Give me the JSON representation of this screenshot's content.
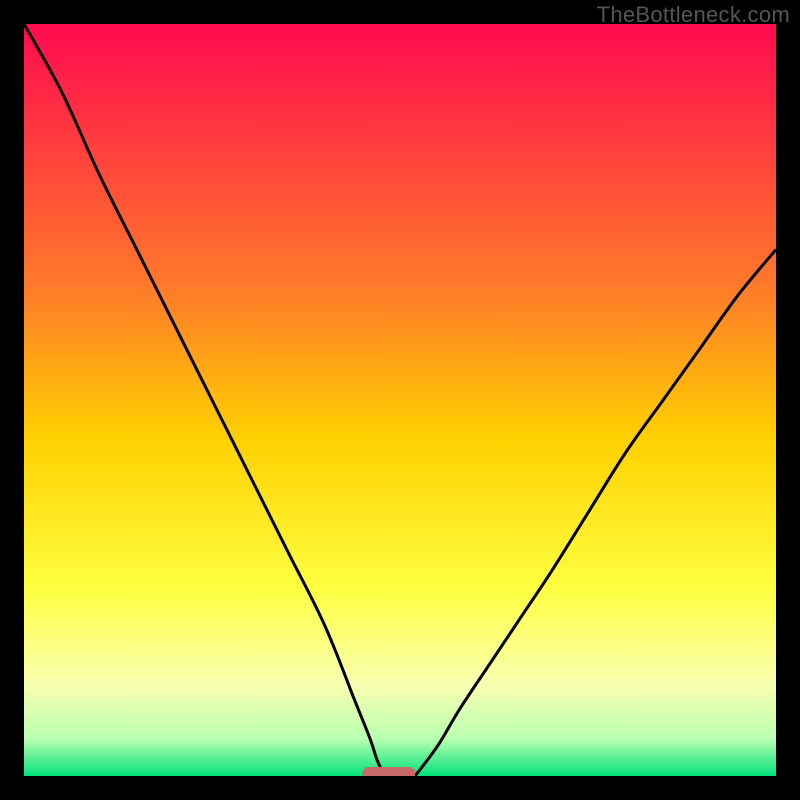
{
  "watermark": "TheBottleneck.com",
  "chart_data": {
    "type": "line",
    "title": "",
    "xlabel": "",
    "ylabel": "",
    "xlim": [
      0,
      100
    ],
    "ylim": [
      0,
      100
    ],
    "gradient_stops": [
      {
        "pos": 0.0,
        "color": "#ff0a4f"
      },
      {
        "pos": 0.35,
        "color": "#ff7a2a"
      },
      {
        "pos": 0.55,
        "color": "#ffd000"
      },
      {
        "pos": 0.75,
        "color": "#ffff40"
      },
      {
        "pos": 0.88,
        "color": "#f8ffb0"
      },
      {
        "pos": 0.95,
        "color": "#baffb0"
      },
      {
        "pos": 1.0,
        "color": "#02e27a"
      }
    ],
    "series": [
      {
        "name": "left-curve",
        "x": [
          0,
          5,
          10,
          15,
          20,
          25,
          30,
          35,
          40,
          44,
          46,
          47,
          48
        ],
        "y": [
          100,
          91,
          80,
          70,
          60,
          50,
          40,
          30,
          20,
          10,
          5,
          2,
          0
        ]
      },
      {
        "name": "right-curve",
        "x": [
          52,
          55,
          58,
          62,
          66,
          70,
          75,
          80,
          85,
          90,
          95,
          100
        ],
        "y": [
          0,
          4,
          9,
          15,
          21,
          27,
          35,
          43,
          50,
          57,
          64,
          70
        ]
      }
    ],
    "marker": {
      "x_start": 45,
      "x_end": 52,
      "y": 0,
      "color": "#c96a6a"
    }
  }
}
